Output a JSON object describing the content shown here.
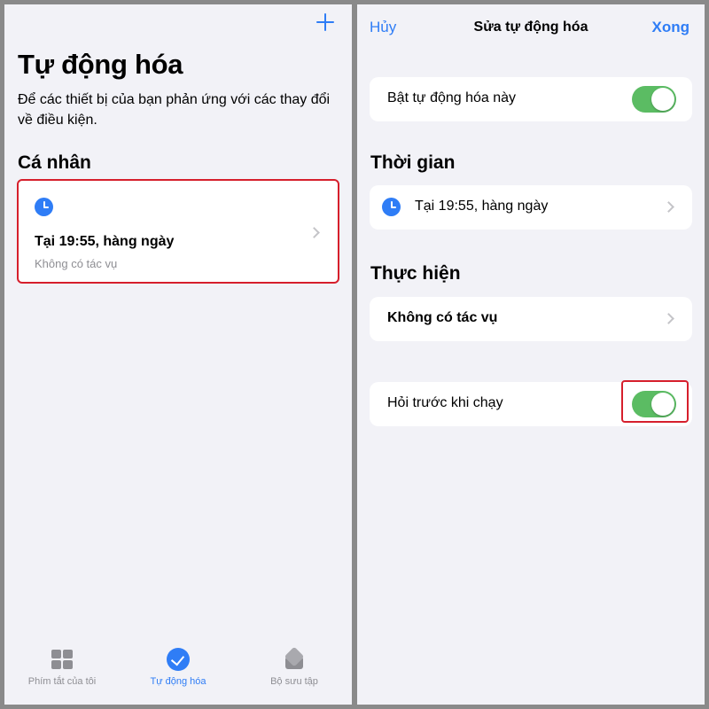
{
  "left": {
    "add_label": "+",
    "title": "Tự động hóa",
    "subtitle": "Để các thiết bị của bạn phản ứng với các thay đổi về điều kiện.",
    "section": "Cá nhân",
    "automation": {
      "icon": "clock-icon",
      "title": "Tại 19:55, hàng ngày",
      "subtitle": "Không có tác vụ"
    },
    "tabs": [
      {
        "label": "Phím tắt của tôi",
        "icon": "grid-icon",
        "active": false
      },
      {
        "label": "Tự động hóa",
        "icon": "automation-check-icon",
        "active": true
      },
      {
        "label": "Bộ sưu tập",
        "icon": "layers-icon",
        "active": false
      }
    ]
  },
  "right": {
    "nav": {
      "cancel": "Hủy",
      "title": "Sửa tự động hóa",
      "done": "Xong"
    },
    "enable": {
      "label": "Bật tự động hóa này",
      "on": true
    },
    "time_section": "Thời gian",
    "time_row": {
      "icon": "clock-icon",
      "label": "Tại 19:55, hàng ngày"
    },
    "do_section": "Thực hiện",
    "do_row": {
      "label": "Không có tác vụ"
    },
    "ask": {
      "label": "Hỏi trước khi chạy",
      "on": true
    }
  },
  "colors": {
    "accent": "#2f7df6",
    "toggle_on": "#5bbc63",
    "highlight": "#d61f2c",
    "background": "#f2f2f7"
  }
}
